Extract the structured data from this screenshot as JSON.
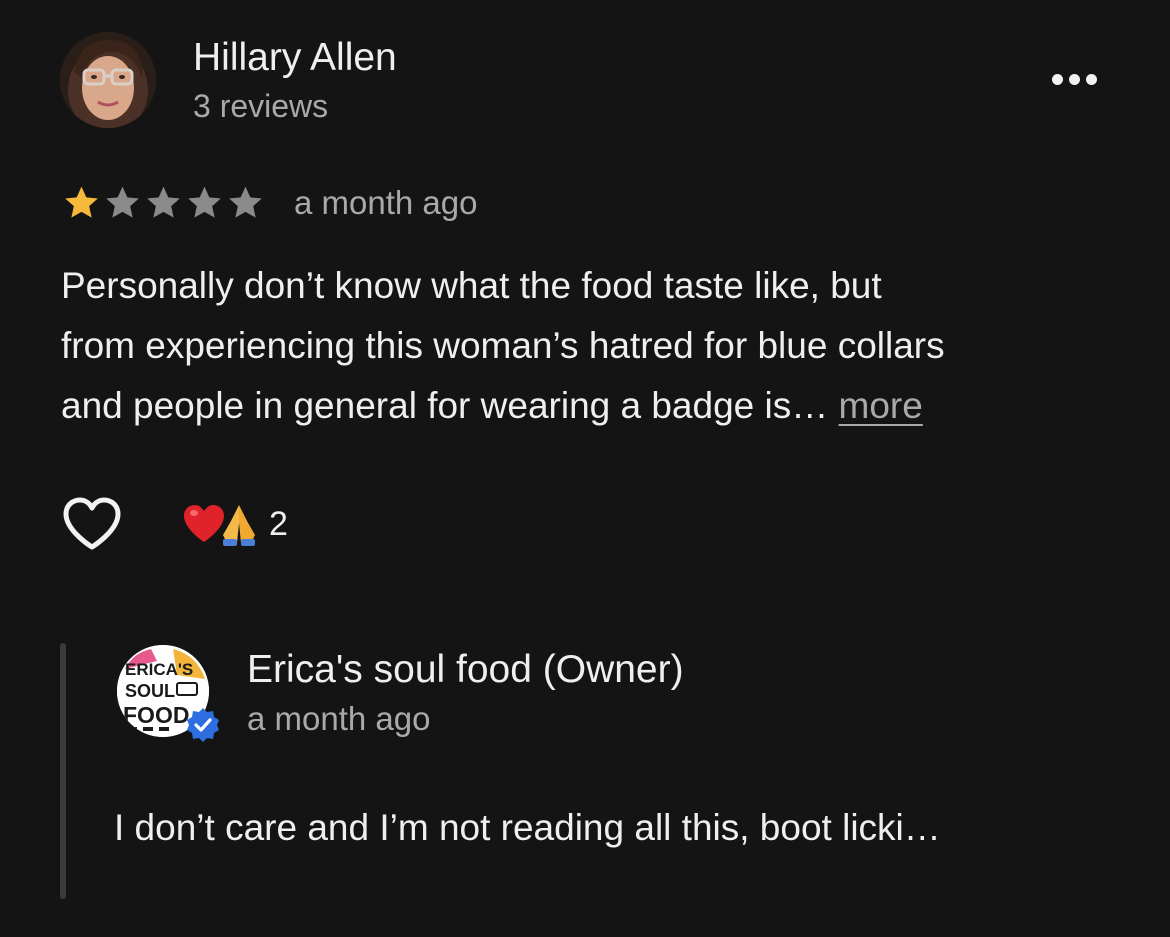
{
  "review": {
    "reviewer_name": "Hillary Allen",
    "review_count": "3 reviews",
    "rating": 1,
    "rating_max": 5,
    "time": "a month ago",
    "text_lines": [
      "Personally don’t know what the food taste like, but",
      "from experiencing this woman’s hatred for blue collars",
      "and people in general for wearing a badge is… "
    ],
    "more_label": "more",
    "reactions": {
      "emojis": [
        "heart-emoji",
        "praying-hands-emoji"
      ],
      "count": "2"
    },
    "icons": {
      "menu": "more-horizontal-icon",
      "like": "heart-outline-icon",
      "star_filled": "star-filled-icon",
      "star_empty": "star-empty-icon"
    }
  },
  "reply": {
    "owner_name": "Erica's soul food (Owner)",
    "time": "a month ago",
    "text": "I don’t care and I’m not reading all this, boot licki…",
    "logo_text": [
      "ERICA'S",
      "SOUL",
      "FOOD"
    ]
  },
  "colors": {
    "background": "#141414",
    "star_filled": "#f6b93b",
    "star_empty": "#8a8a8a",
    "verified": "#2d6fe0",
    "secondary_text": "#a9a9a9"
  }
}
